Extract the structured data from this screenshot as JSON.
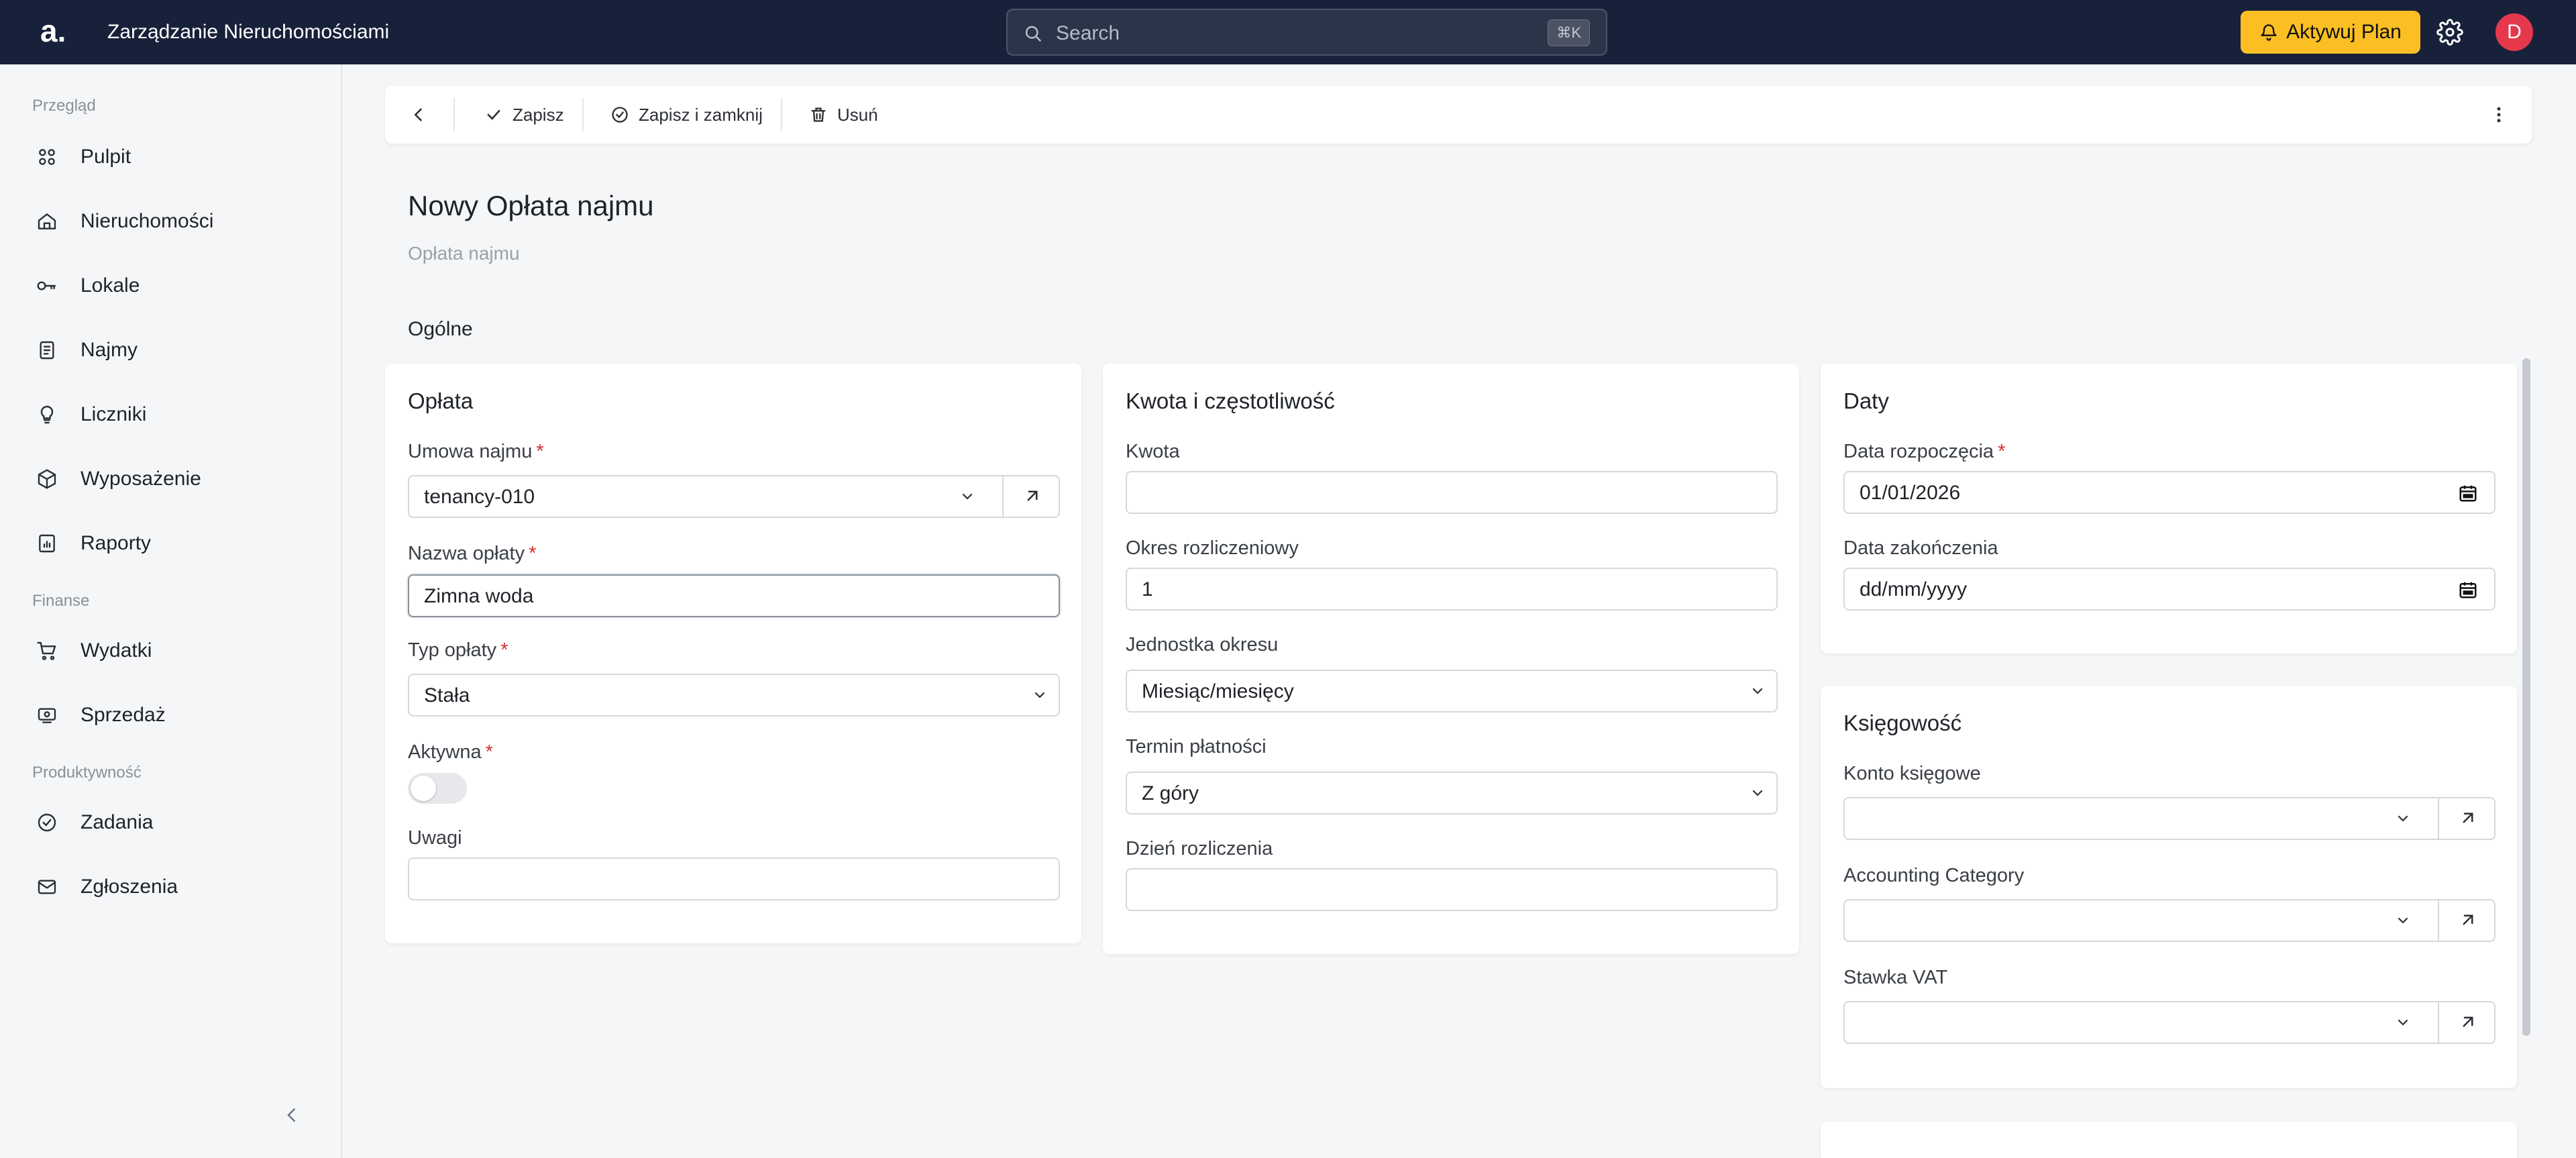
{
  "app": {
    "logo": "a.",
    "title": "Zarządzanie Nieruchomościami"
  },
  "search": {
    "placeholder": "Search",
    "shortcut": "⌘K"
  },
  "header": {
    "plan_button": "Aktywuj Plan",
    "avatar_initial": "D"
  },
  "sidebar": {
    "sections": [
      {
        "label": "Przegląd",
        "items": [
          {
            "label": "Pulpit",
            "icon": "grid-icon"
          },
          {
            "label": "Nieruchomości",
            "icon": "house-icon"
          },
          {
            "label": "Lokale",
            "icon": "key-icon"
          },
          {
            "label": "Najmy",
            "icon": "document-icon"
          },
          {
            "label": "Liczniki",
            "icon": "lightbulb-icon"
          },
          {
            "label": "Wyposażenie",
            "icon": "box-icon"
          },
          {
            "label": "Raporty",
            "icon": "report-icon"
          }
        ]
      },
      {
        "label": "Finanse",
        "items": [
          {
            "label": "Wydatki",
            "icon": "cart-icon"
          },
          {
            "label": "Sprzedaż",
            "icon": "cash-icon"
          }
        ]
      },
      {
        "label": "Produktywność",
        "items": [
          {
            "label": "Zadania",
            "icon": "check-circle-icon"
          },
          {
            "label": "Zgłoszenia",
            "icon": "mail-icon"
          }
        ]
      }
    ]
  },
  "toolbar": {
    "save_label": "Zapisz",
    "save_close_label": "Zapisz i zamknij",
    "delete_label": "Usuń"
  },
  "page": {
    "title": "Nowy Opłata najmu",
    "subtitle": "Opłata najmu",
    "section": "Ogólne"
  },
  "card_fee": {
    "title": "Opłata",
    "tenancy_label": "Umowa najmu",
    "tenancy_value": "tenancy-010",
    "fee_name_label": "Nazwa opłaty",
    "fee_name_value": "Zimna woda",
    "fee_type_label": "Typ opłaty",
    "fee_type_value": "Stała",
    "active_label": "Aktywna",
    "active_value": false,
    "notes_label": "Uwagi",
    "notes_value": ""
  },
  "card_amount": {
    "title": "Kwota i częstotliwość",
    "amount_label": "Kwota",
    "amount_value": "",
    "period_label": "Okres rozliczeniowy",
    "period_value": "1",
    "period_unit_label": "Jednostka okresu",
    "period_unit_value": "Miesiąc/miesięcy",
    "payment_term_label": "Termin płatności",
    "payment_term_value": "Z góry",
    "billing_day_label": "Dzień rozliczenia",
    "billing_day_value": ""
  },
  "card_dates": {
    "title": "Daty",
    "start_label": "Data rozpoczęcia",
    "start_value": "01/01/2026",
    "end_label": "Data zakończenia",
    "end_value": "dd/mm/yyyy"
  },
  "card_accounting": {
    "title": "Księgowość",
    "account_label": "Konto księgowe",
    "category_label": "Accounting Category",
    "vat_label": "Stawka VAT"
  },
  "colors": {
    "topbar": "#18213a",
    "accent": "#fbbf24",
    "avatar": "#e5384c",
    "required": "#d32f2f"
  }
}
